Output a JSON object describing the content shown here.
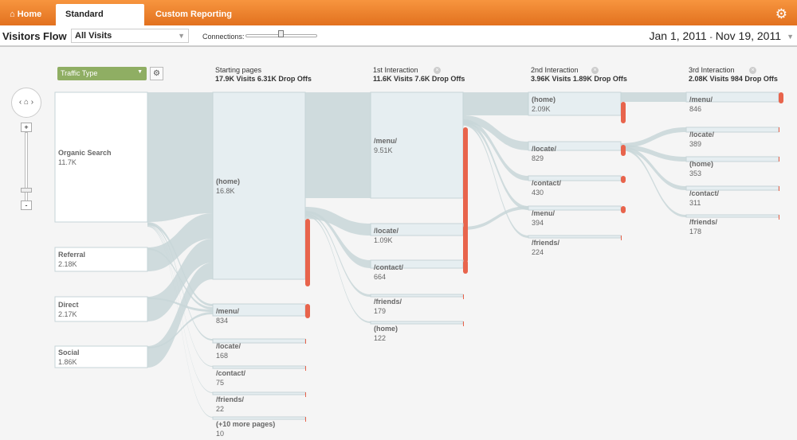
{
  "nav": {
    "tabs": [
      {
        "label": "Home",
        "icon": "home-icon"
      },
      {
        "label": "Standard Reporting",
        "active": true
      },
      {
        "label": "Custom Reporting"
      }
    ],
    "settings_icon": "gear-icon"
  },
  "header": {
    "title": "Visitors Flow",
    "segment": "All Visits",
    "connections_label": "Connections:",
    "connections_level": 0.45,
    "date_start": "Jan 1, 2011",
    "date_sep": "-",
    "date_end": "Nov 19, 2011"
  },
  "dimension": {
    "label": "Traffic Type"
  },
  "colors": {
    "accent": "#f08030",
    "flow": "#c8d6d8",
    "dropoff": "#e8644c",
    "dimension": "#8fae63"
  },
  "columns": [
    {
      "title": "",
      "stats": ""
    },
    {
      "title": "Starting pages",
      "stats": "17.9K Visits 6.31K Drop Offs"
    },
    {
      "title": "1st Interaction",
      "stats": "11.6K Visits 7.6K Drop Offs"
    },
    {
      "title": "2nd Interaction",
      "stats": "3.96K Visits 1.89K Drop Offs"
    },
    {
      "title": "3rd Interaction",
      "stats": "2.08K Visits 984 Drop Offs"
    }
  ],
  "nodes": [
    [
      {
        "label": "Organic Search",
        "value": "11.7K"
      },
      {
        "label": "Referral",
        "value": "2.18K"
      },
      {
        "label": "Direct",
        "value": "2.17K"
      },
      {
        "label": "Social",
        "value": "1.86K"
      }
    ],
    [
      {
        "label": "(home)",
        "value": "16.8K"
      },
      {
        "label": "/menu/",
        "value": "834"
      },
      {
        "label": "/locate/",
        "value": "168"
      },
      {
        "label": "/contact/",
        "value": "75"
      },
      {
        "label": "/friends/",
        "value": "22"
      },
      {
        "label": "(+10 more pages)",
        "value": "10"
      }
    ],
    [
      {
        "label": "/menu/",
        "value": "9.51K"
      },
      {
        "label": "/locate/",
        "value": "1.09K"
      },
      {
        "label": "/contact/",
        "value": "664"
      },
      {
        "label": "/friends/",
        "value": "179"
      },
      {
        "label": "(home)",
        "value": "122"
      }
    ],
    [
      {
        "label": "(home)",
        "value": "2.09K"
      },
      {
        "label": "/locate/",
        "value": "829"
      },
      {
        "label": "/contact/",
        "value": "430"
      },
      {
        "label": "/menu/",
        "value": "394"
      },
      {
        "label": "/friends/",
        "value": "224"
      }
    ],
    [
      {
        "label": "/menu/",
        "value": "846"
      },
      {
        "label": "/locate/",
        "value": "389"
      },
      {
        "label": "(home)",
        "value": "353"
      },
      {
        "label": "/contact/",
        "value": "311"
      },
      {
        "label": "/friends/",
        "value": "178"
      }
    ]
  ]
}
